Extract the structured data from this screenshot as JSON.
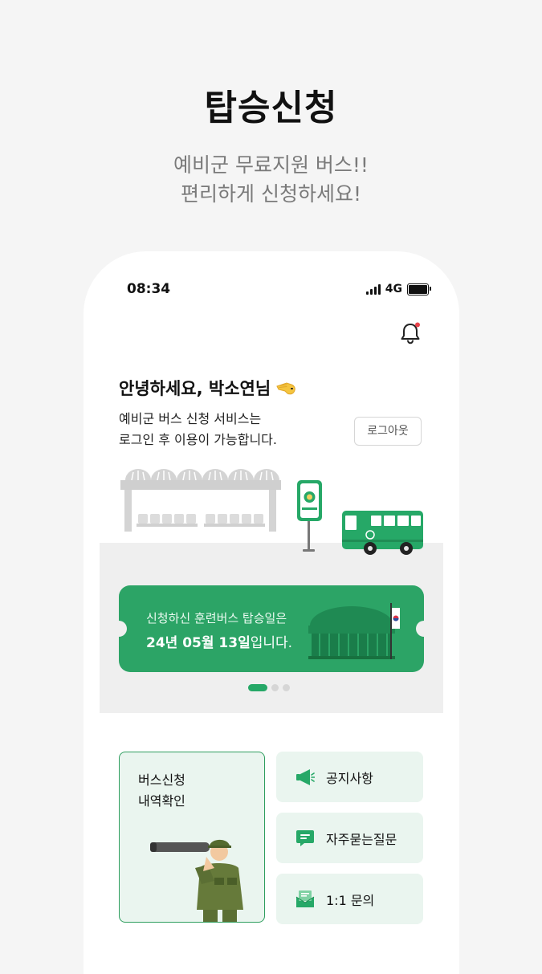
{
  "promo": {
    "title": "탑승신청",
    "subtitle_line1": "예비군 무료지원 버스!!",
    "subtitle_line2": "편리하게 신청하세요!"
  },
  "status_bar": {
    "time": "08:34",
    "network": "4G",
    "battery_level": 1.0
  },
  "header": {
    "bell_icon": "bell-icon",
    "has_notification": true
  },
  "greeting": {
    "text": "안녕하세요, 박소연님",
    "emoji_icon": "salute-hand-icon",
    "info_line1": "예비군 버스 신청 서비스는",
    "info_line2": "로그인 후 이용이 가능합니다.",
    "logout_label": "로그아웃"
  },
  "illustration": {
    "bus_stop_sign": "예비군 버스"
  },
  "banner": {
    "line1": "신청하신 훈련버스 탑승일은",
    "date": "24년 05월 13일",
    "suffix": "입니다.",
    "pages_total": 3,
    "pages_active": 1
  },
  "menu": {
    "history_line1": "버스신청",
    "history_line2": "내역확인",
    "notice": "공지사항",
    "faq": "자주묻는질문",
    "inquiry": "1:1 문의"
  },
  "colors": {
    "brand_green": "#26a867",
    "card_bg": "#eaf5ef",
    "notification_dot": "#e8424a"
  }
}
